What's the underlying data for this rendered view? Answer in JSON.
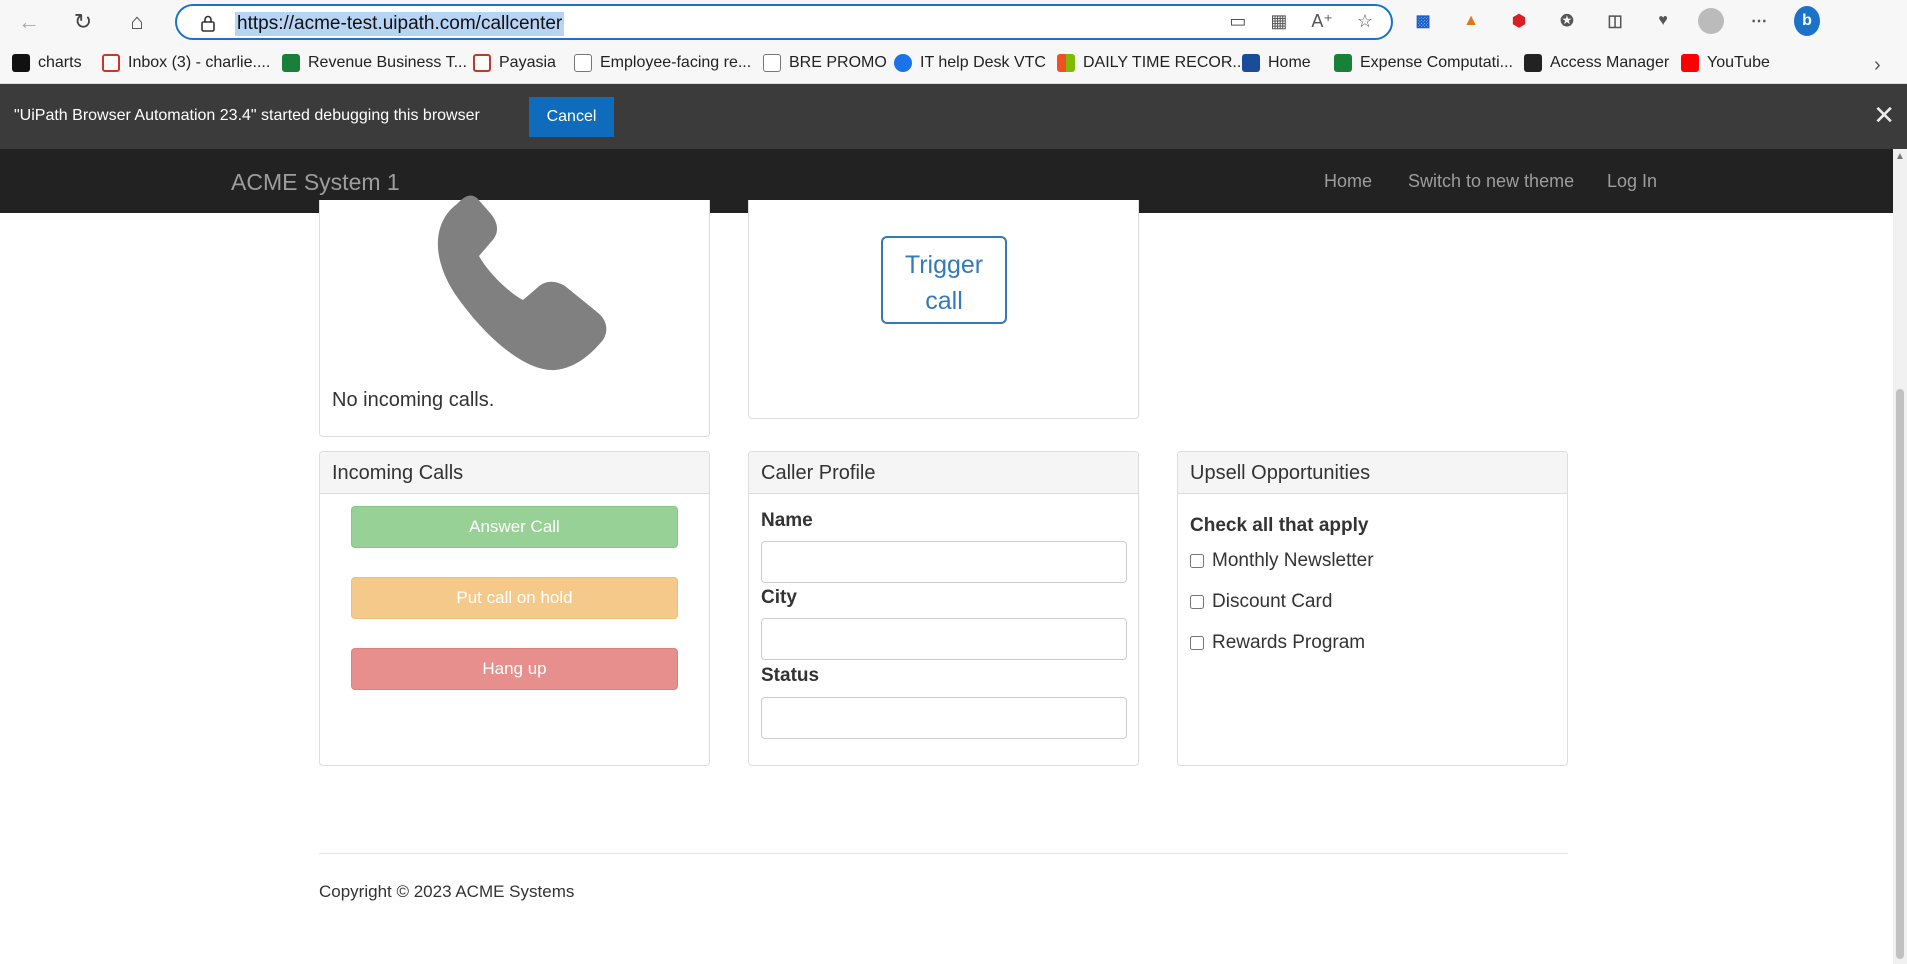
{
  "browser": {
    "url": "https://acme-test.uipath.com/callcenter",
    "bookmarks": [
      {
        "label": "charts",
        "icon": "tradingview-icon",
        "color": "#111111"
      },
      {
        "label": "Inbox (3) - charlie....",
        "icon": "gmail-icon",
        "color": "#d93025"
      },
      {
        "label": "Revenue Business T...",
        "icon": "sheets-icon",
        "color": "#188038"
      },
      {
        "label": "Payasia",
        "icon": "payasia-icon",
        "color": "#c0392b"
      },
      {
        "label": "Employee-facing re...",
        "icon": "page-icon",
        "color": "#777777"
      },
      {
        "label": "BRE PROMO",
        "icon": "page-icon",
        "color": "#777777"
      },
      {
        "label": "IT help Desk VTC",
        "icon": "helpdesk-icon",
        "color": "#1a73e8"
      },
      {
        "label": "DAILY TIME RECOR...",
        "icon": "microsoft-icon",
        "color": "#f25022"
      },
      {
        "label": "Home",
        "icon": "sf-icon",
        "color": "#1a4c9c"
      },
      {
        "label": "Expense Computati...",
        "icon": "sheets-icon",
        "color": "#188038"
      },
      {
        "label": "Access Manager",
        "icon": "access-icon",
        "color": "#222222"
      },
      {
        "label": "YouTube",
        "icon": "youtube-icon",
        "color": "#ff0000"
      }
    ]
  },
  "infobar": {
    "message": "\"UiPath Browser Automation 23.4\" started debugging this browser",
    "cancel_label": "Cancel"
  },
  "navbar": {
    "brand": "ACME System 1",
    "links": [
      "Home",
      "Switch to new theme",
      "Log In"
    ]
  },
  "phone_panel": {
    "status": "No incoming calls."
  },
  "trigger": {
    "label_line1": "Trigger",
    "label_line2": "call"
  },
  "incoming_calls": {
    "title": "Incoming Calls",
    "answer_label": "Answer Call",
    "hold_label": "Put call on hold",
    "hangup_label": "Hang up"
  },
  "caller_profile": {
    "title": "Caller Profile",
    "name_label": "Name",
    "name_value": "",
    "city_label": "City",
    "city_value": "",
    "status_label": "Status",
    "status_value": ""
  },
  "upsell": {
    "title": "Upsell Opportunities",
    "instruction": "Check all that apply",
    "options": [
      {
        "label": "Monthly Newsletter",
        "checked": false
      },
      {
        "label": "Discount Card",
        "checked": false
      },
      {
        "label": "Rewards Program",
        "checked": false
      }
    ]
  },
  "footer": {
    "copyright": "Copyright © 2023 ACME Systems"
  },
  "colors": {
    "navbar_bg": "#222222",
    "answer_green": "#97d195",
    "hold_orange": "#f5c98a",
    "hangup_red": "#e68f8c",
    "link_blue": "#337ab7",
    "infobar_cancel_blue": "#0f6cbd"
  }
}
